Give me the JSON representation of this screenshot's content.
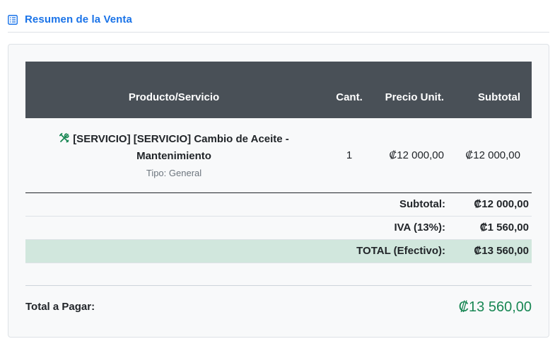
{
  "header": {
    "title": "Resumen de la Venta",
    "icon": "receipt-icon"
  },
  "table": {
    "columns": {
      "product": "Producto/Servicio",
      "qty": "Cant.",
      "price": "Precio Unit.",
      "subtotal": "Subtotal"
    },
    "items": [
      {
        "icon": "tools-icon",
        "name_line1": "[SERVICIO] [SERVICIO] Cambio de Aceite -",
        "name_line2": "Mantenimiento",
        "type": "Tipo: General",
        "qty": "1",
        "price": "₡12 000,00",
        "subtotal": "₡12 000,00"
      }
    ]
  },
  "totals": {
    "subtotal_label": "Subtotal:",
    "subtotal_value": "₡12 000,00",
    "iva_label": "IVA (13%):",
    "iva_value": "₡1 560,00",
    "total_label": "TOTAL (Efectivo):",
    "total_value": "₡13 560,00"
  },
  "payment": {
    "label": "Total a Pagar:",
    "value": "₡13 560,00"
  },
  "colors": {
    "accent": "#1a73e8",
    "header_bg": "#495057",
    "total_row_bg": "#d1e7dd",
    "pay_green": "#198754"
  }
}
